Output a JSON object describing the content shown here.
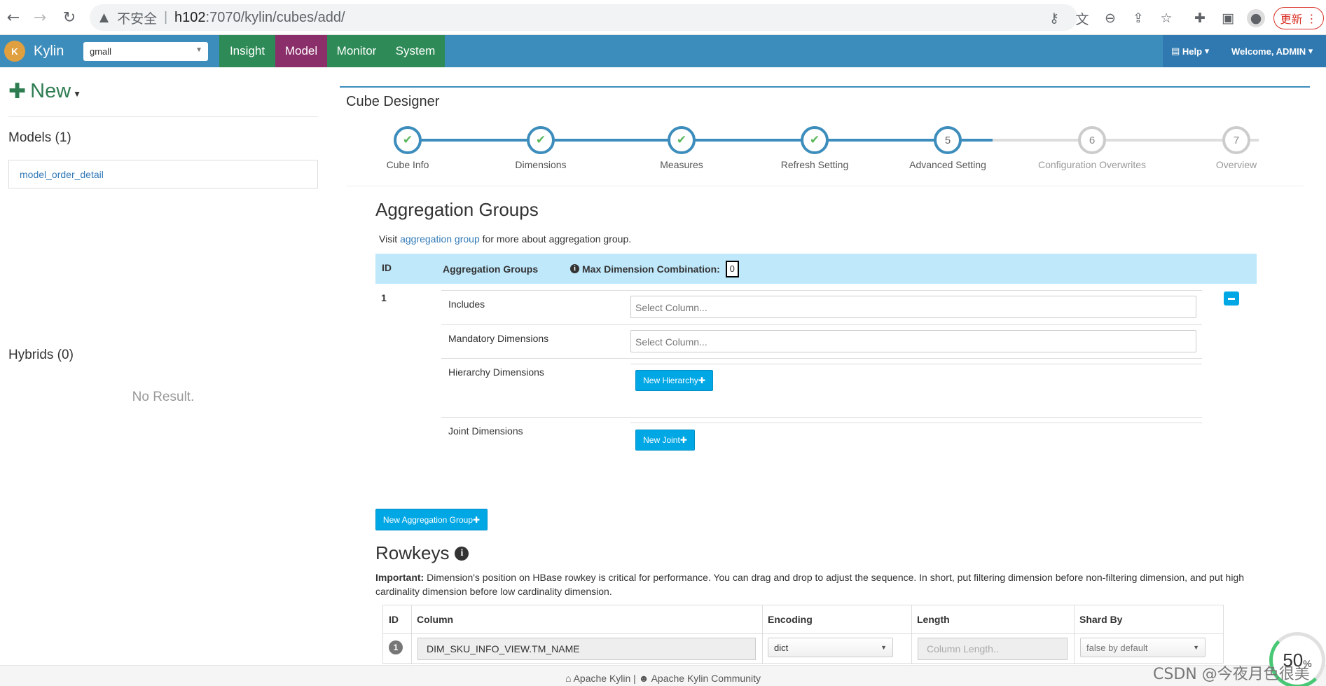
{
  "browser": {
    "security_label": "不安全",
    "url_host": "h102",
    "url_path": ":7070/kylin/cubes/add/",
    "update_label": "更新"
  },
  "nav": {
    "brand": "Kylin",
    "project": "gmall",
    "tabs": [
      {
        "label": "Insight",
        "active": false
      },
      {
        "label": "Model",
        "active": true
      },
      {
        "label": "Monitor",
        "active": false
      },
      {
        "label": "System",
        "active": false
      }
    ],
    "help_label": "Help",
    "welcome_label": "Welcome, ADMIN"
  },
  "sidebar": {
    "new_label": "New",
    "models_heading": "Models (1)",
    "models": [
      "model_order_detail"
    ],
    "hybrids_heading": "Hybrids (0)",
    "no_result": "No Result."
  },
  "designer": {
    "title": "Cube Designer",
    "steps": [
      {
        "num": "1",
        "label": "Cube Info",
        "state": "done"
      },
      {
        "num": "2",
        "label": "Dimensions",
        "state": "done"
      },
      {
        "num": "3",
        "label": "Measures",
        "state": "done"
      },
      {
        "num": "4",
        "label": "Refresh Setting",
        "state": "done"
      },
      {
        "num": "5",
        "label": "Advanced Setting",
        "state": "current"
      },
      {
        "num": "6",
        "label": "Configuration Overwrites",
        "state": "todo"
      },
      {
        "num": "7",
        "label": "Overview",
        "state": "todo"
      }
    ]
  },
  "aggregation": {
    "heading": "Aggregation Groups",
    "visit_prefix": "Visit ",
    "visit_link": "aggregation group",
    "visit_suffix": " for more about aggregation group.",
    "col_id": "ID",
    "col_groups": "Aggregation Groups",
    "max_dim_label": "Max Dimension Combination:",
    "max_dim_value": "0",
    "row_id": "1",
    "includes_label": "Includes",
    "includes_placeholder": "Select Column...",
    "mandatory_label": "Mandatory Dimensions",
    "mandatory_placeholder": "Select Column...",
    "hierarchy_label": "Hierarchy Dimensions",
    "new_hierarchy_button": "New Hierarchy",
    "joint_label": "Joint Dimensions",
    "new_joint_button": "New Joint",
    "new_group_button": "New Aggregation Group"
  },
  "rowkeys": {
    "heading": "Rowkeys",
    "note_strong": "Important:",
    "note_text": " Dimension's position on HBase rowkey is critical for performance. You can drag and drop to adjust the sequence. In short, put filtering dimension before non-filtering dimension, and put high cardinality dimension before low cardinality dimension.",
    "columns": [
      "ID",
      "Column",
      "Encoding",
      "Length",
      "Shard By"
    ],
    "rows": [
      {
        "id": "1",
        "column": "DIM_SKU_INFO_VIEW.TM_NAME",
        "encoding": "dict",
        "length_placeholder": "Column Length..",
        "shard_by": "false by default"
      }
    ]
  },
  "footer": {
    "apache_kylin": "Apache Kylin",
    "separator": " | ",
    "community": "Apache Kylin Community"
  },
  "watermark": "CSDN @今夜月色很美",
  "zoom": {
    "value": "50",
    "unit": "%"
  }
}
